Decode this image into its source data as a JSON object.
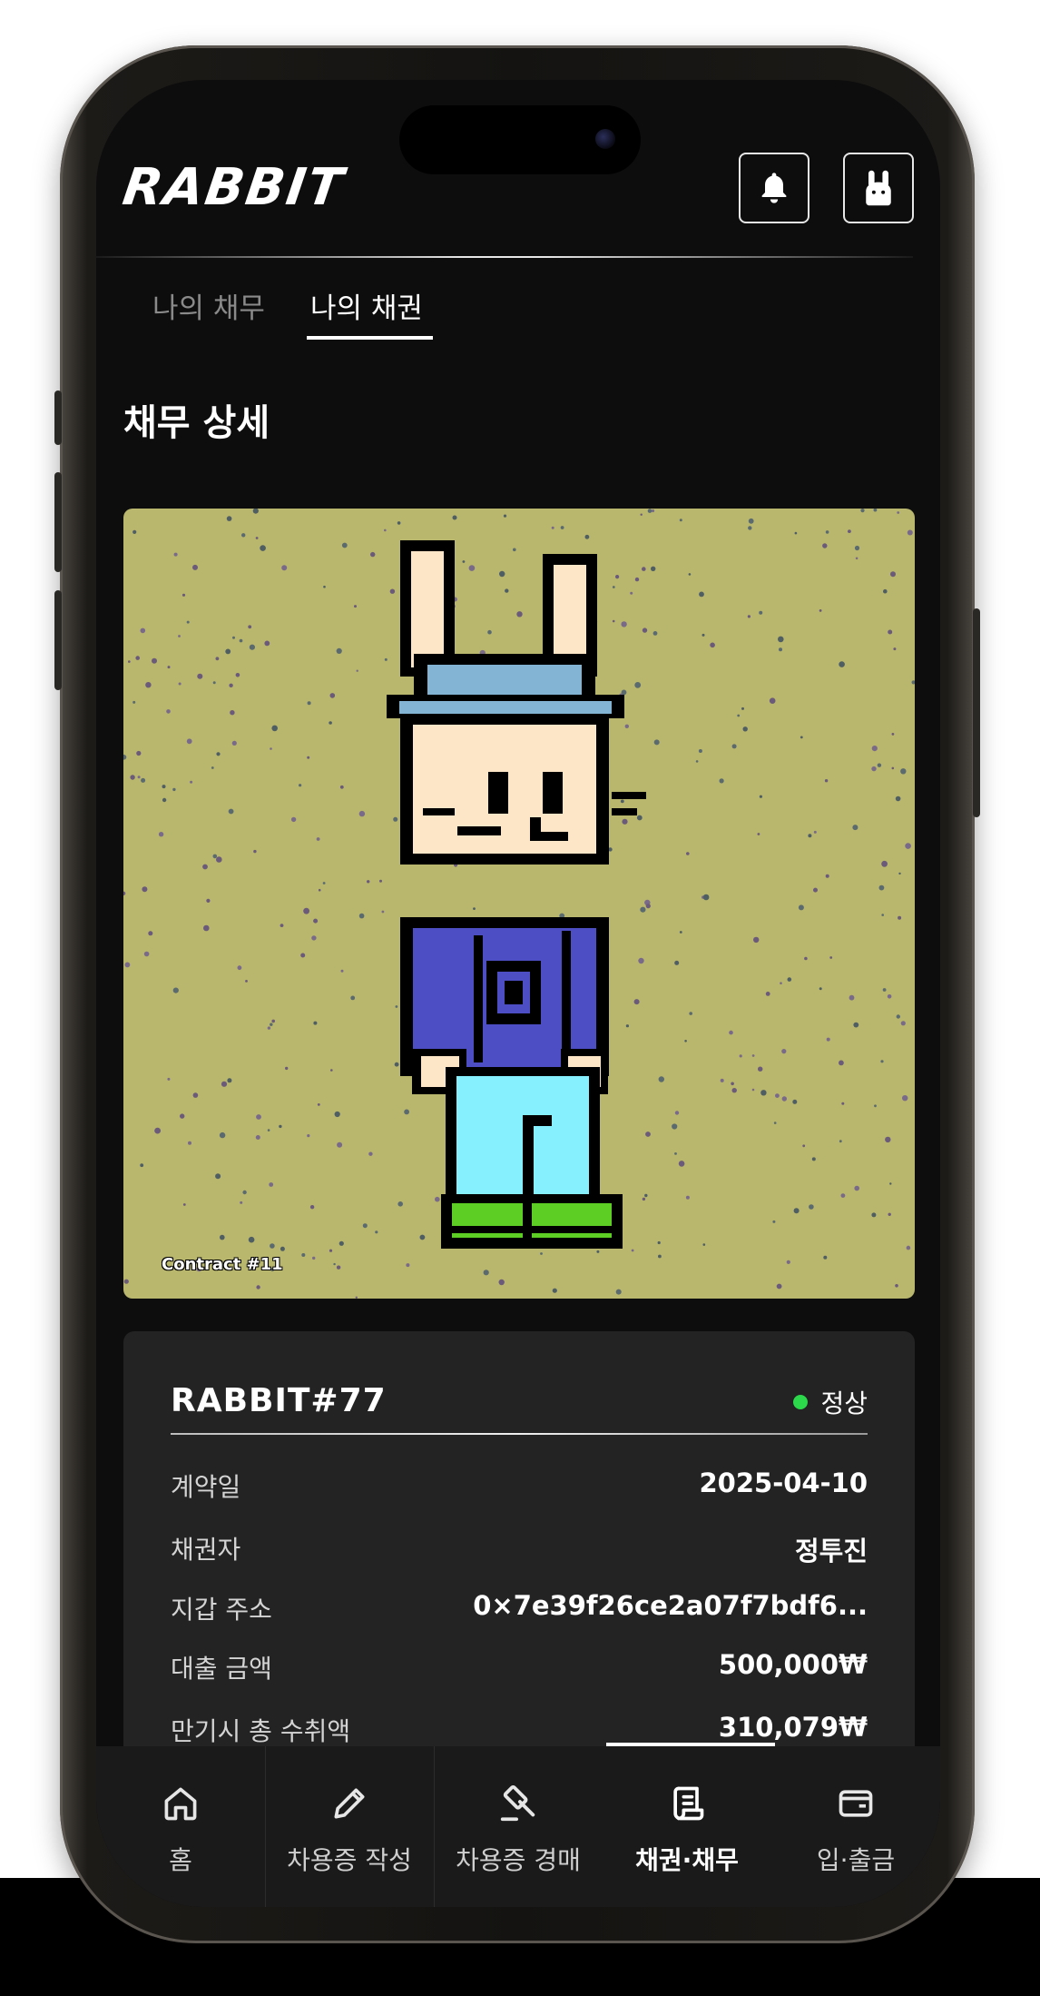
{
  "app": {
    "logo_text": "RABBIT"
  },
  "header": {
    "bell_icon": "bell-icon",
    "profile_icon": "rabbit-profile-icon"
  },
  "tabs": [
    {
      "label": "나의 채무",
      "active": false
    },
    {
      "label": "나의 채권",
      "active": true
    }
  ],
  "page": {
    "title": "채무 상세"
  },
  "nft": {
    "contract_label": "Contract #11",
    "background_color": "#b9b66e"
  },
  "detail": {
    "title": "RABBIT#77",
    "status": {
      "text": "정상",
      "color": "#2bd94a"
    },
    "rows": [
      {
        "label": "계약일",
        "value": "2025-04-10"
      },
      {
        "label": "채권자",
        "value": "정투진"
      },
      {
        "label": "지갑 주소",
        "value": "0×7e39f26ce2a07f7bdf6..."
      },
      {
        "label": "대출 금액",
        "value": "500,000₩"
      },
      {
        "label": "만기시 총 수취액",
        "value": "310,079₩"
      }
    ]
  },
  "bottom_nav": [
    {
      "label": "홈",
      "icon": "home-icon",
      "active": false
    },
    {
      "label": "차용증 작성",
      "icon": "pencil-icon",
      "active": false
    },
    {
      "label": "차용증 경매",
      "icon": "gavel-icon",
      "active": false
    },
    {
      "label": "채권·채무",
      "icon": "scroll-icon",
      "active": true
    },
    {
      "label": "입·출금",
      "icon": "wallet-icon",
      "active": false
    }
  ]
}
